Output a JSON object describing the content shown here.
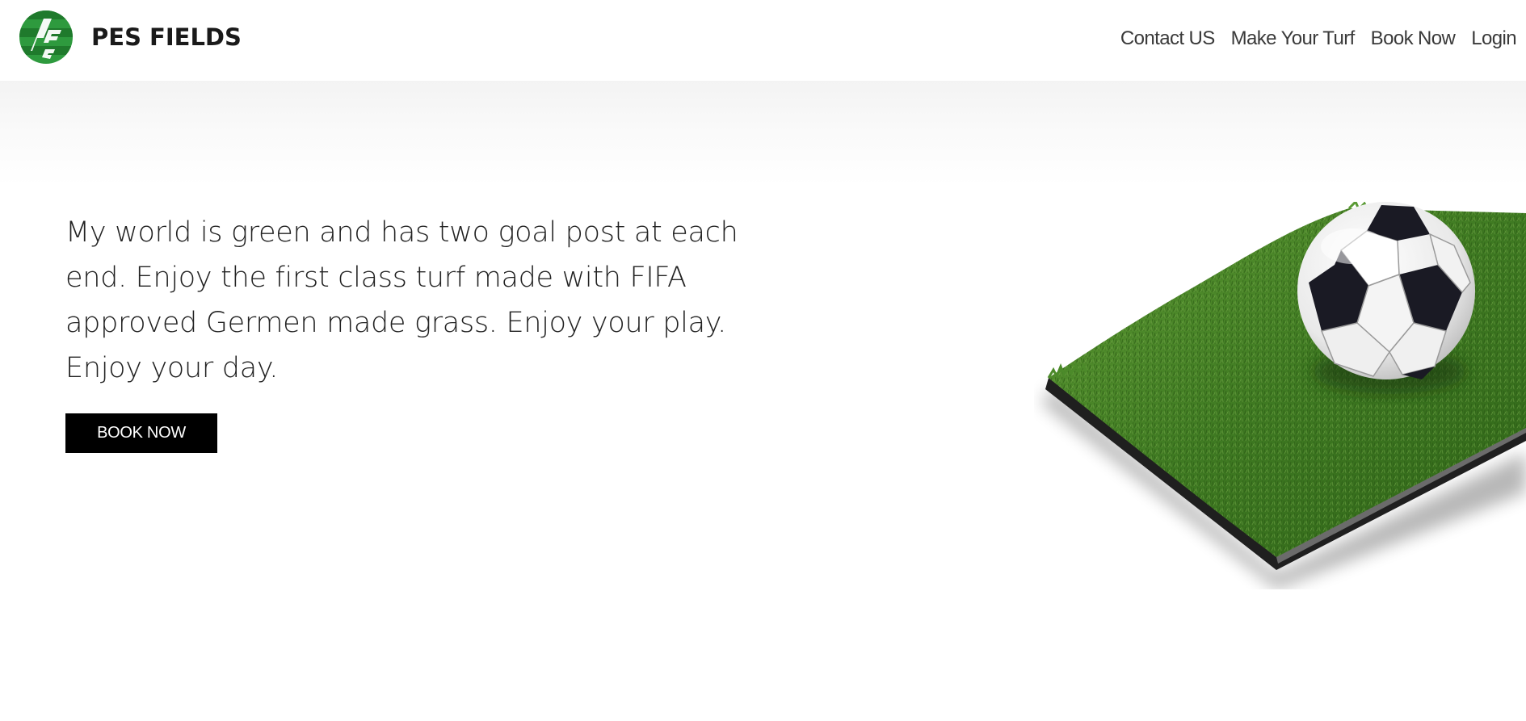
{
  "header": {
    "brand_name": "PES FIELDS",
    "logo_letters": [
      "P",
      "E",
      "S"
    ],
    "nav": [
      {
        "label": "Contact US"
      },
      {
        "label": "Make Your Turf"
      },
      {
        "label": "Book Now"
      },
      {
        "label": "Login"
      }
    ]
  },
  "hero": {
    "tagline": "My world is green and has two goal post at each end. Enjoy the first class turf made with FIFA approved Germen made grass. Enjoy your play. Enjoy your day.",
    "cta_label": "BOOK NOW",
    "image": "soccer-ball-on-turf"
  },
  "colors": {
    "logo_green": "#2e9a3e",
    "logo_dark_green": "#1f7a2c",
    "button_bg": "#000000",
    "button_text": "#ffffff",
    "grass": "#3f7a22"
  }
}
